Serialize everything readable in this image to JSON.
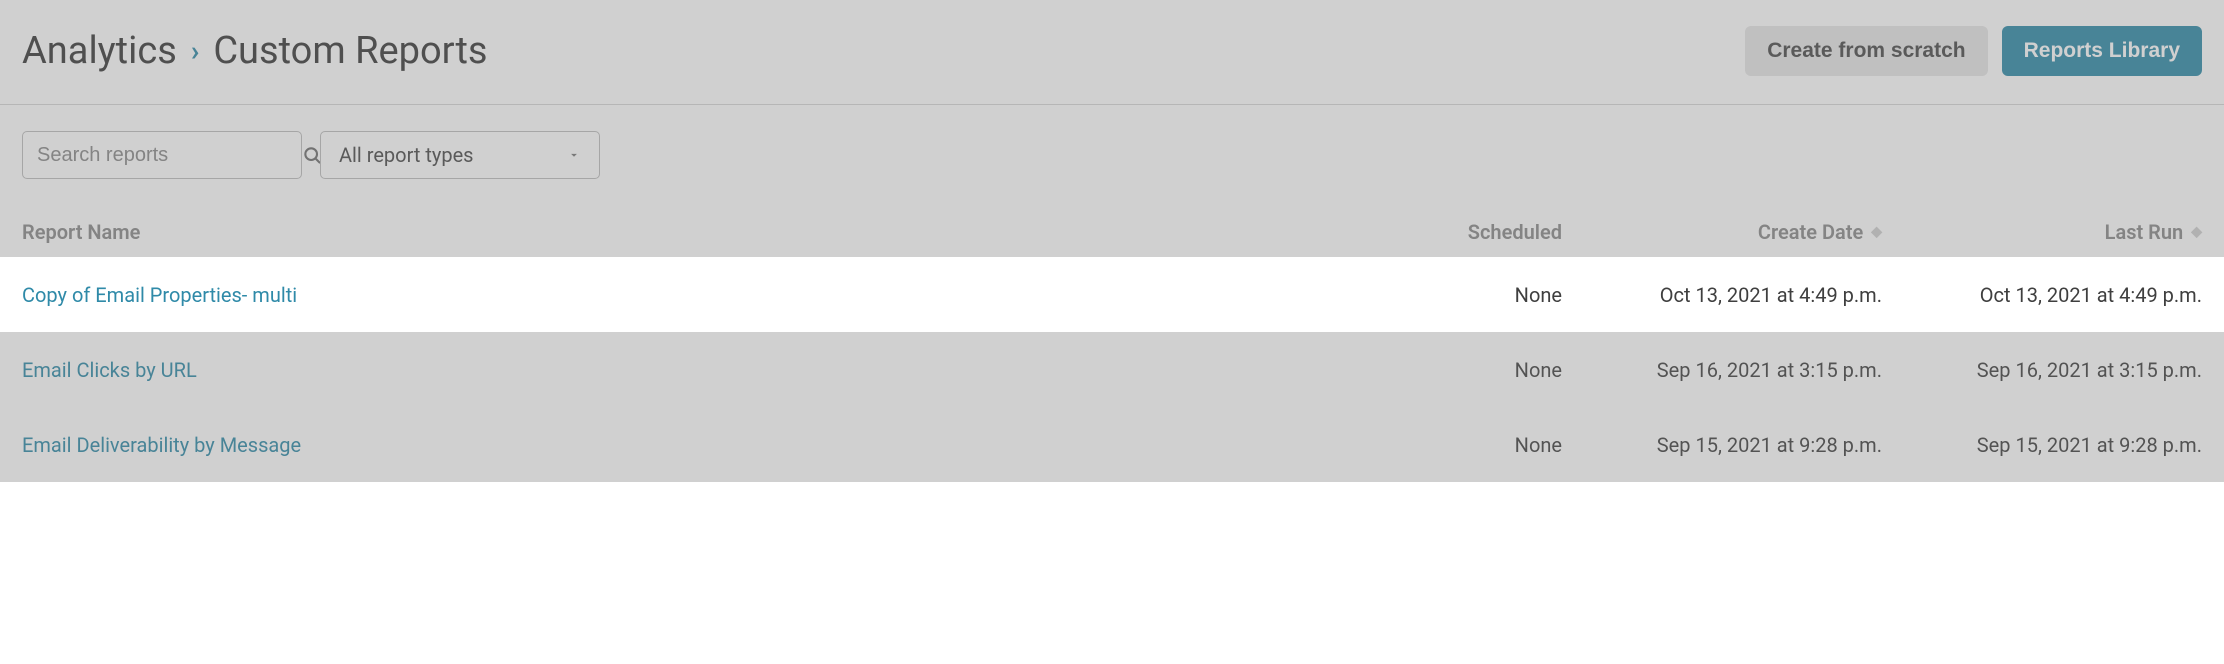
{
  "breadcrumb": {
    "root": "Analytics",
    "current": "Custom Reports"
  },
  "header_buttons": {
    "create_from_scratch": "Create from scratch",
    "reports_library": "Reports Library"
  },
  "filters": {
    "search_placeholder": "Search reports",
    "type_selected": "All report types"
  },
  "table": {
    "columns": {
      "name": "Report Name",
      "scheduled": "Scheduled",
      "create_date": "Create Date",
      "last_run": "Last Run"
    },
    "rows": [
      {
        "name": "Copy of Email Properties- multi",
        "scheduled": "None",
        "create_date": "Oct 13, 2021 at 4:49 p.m.",
        "last_run": "Oct 13, 2021 at 4:49 p.m.",
        "highlight": true
      },
      {
        "name": "Email Clicks by URL",
        "scheduled": "None",
        "create_date": "Sep 16, 2021 at 3:15 p.m.",
        "last_run": "Sep 16, 2021 at 3:15 p.m.",
        "highlight": false
      },
      {
        "name": "Email Deliverability by Message",
        "scheduled": "None",
        "create_date": "Sep 15, 2021 at 9:28 p.m.",
        "last_run": "Sep 15, 2021 at 9:28 p.m.",
        "highlight": false
      }
    ]
  }
}
